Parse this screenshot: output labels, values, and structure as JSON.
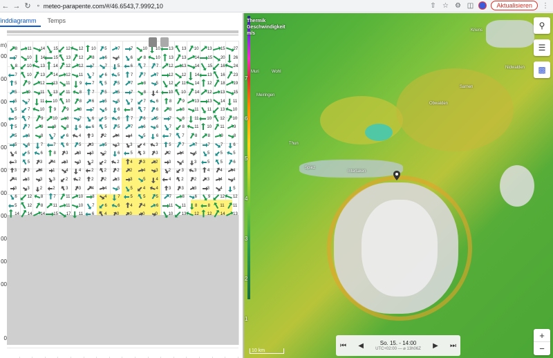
{
  "browser": {
    "url": "meteo-parapente.com/#/46.6543,7.9992,10",
    "update_label": "Aktualisieren"
  },
  "tabs": [
    {
      "label": "Winddiagramm"
    },
    {
      "label": "Temps"
    }
  ],
  "altitudes": [
    "m)",
    "00",
    "00",
    "00",
    "00",
    "00",
    "00",
    "00",
    "00",
    "00",
    "00",
    "00",
    "0"
  ],
  "hours": [
    "6h",
    "7h",
    "8h",
    "9h",
    "10h",
    "11h",
    "12h",
    "13h",
    "14h",
    "15h",
    "16h",
    "17h",
    "18h",
    "19h",
    "20h",
    "21h",
    "22h",
    "23h"
  ],
  "row_values": [
    [
      "8",
      "11",
      "14",
      "15",
      "12",
      "12",
      "10",
      "5",
      "7",
      "7",
      "10",
      "10",
      "13",
      "13",
      "10",
      "13",
      "15",
      "27"
    ],
    [
      "7",
      "10",
      "14",
      "15",
      "13",
      "12",
      "8",
      "6",
      "4",
      "6",
      "8",
      "10",
      "13",
      "13",
      "14",
      "15",
      "20",
      "26"
    ],
    [
      "8",
      "10",
      "13",
      "14",
      "12",
      "12",
      "7",
      "7",
      "5",
      "6",
      "7",
      "7",
      "12",
      "13",
      "14",
      "15",
      "16",
      "24"
    ],
    [
      "7",
      "10",
      "13",
      "14",
      "12",
      "11",
      "7",
      "6",
      "5",
      "7",
      "7",
      "7",
      "12",
      "12",
      "14",
      "13",
      "16",
      "23"
    ],
    [
      "5",
      "9",
      "12",
      "13",
      "11",
      "9",
      "7",
      "5",
      "5",
      "7",
      "8",
      "5",
      "12",
      "11",
      "14",
      "12",
      "18",
      "19"
    ],
    [
      "5",
      "9",
      "11",
      "13",
      "11",
      "8",
      "7",
      "5",
      "5",
      "7",
      "8",
      "4",
      "10",
      "10",
      "14",
      "12",
      "13",
      "15"
    ],
    [
      "5",
      "7",
      "11",
      "10",
      "10",
      "8",
      "6",
      "5",
      "5",
      "7",
      "7",
      "6",
      "8",
      "9",
      "13",
      "13",
      "14",
      "11"
    ],
    [
      "5",
      "7",
      "10",
      "9",
      "9",
      "8",
      "7",
      "6",
      "6",
      "8",
      "7",
      "6",
      "8",
      "8",
      "11",
      "11",
      "13",
      "10"
    ],
    [
      "5",
      "7",
      "9",
      "10",
      "8",
      "7",
      "6",
      "5",
      "6",
      "7",
      "6",
      "5",
      "7",
      "8",
      "11",
      "10",
      "12",
      "10"
    ],
    [
      "5",
      "7",
      "9",
      "9",
      "8",
      "6",
      "6",
      "5",
      "5",
      "7",
      "6",
      "6",
      "7",
      "8",
      "11",
      "10",
      "11",
      "9"
    ],
    [
      "5",
      "6",
      "8",
      "7",
      "6",
      "4",
      "3",
      "2",
      "4",
      "4",
      "5",
      "6",
      "7",
      "7",
      "8",
      "8",
      "9",
      "8"
    ],
    [
      "5",
      "6",
      "7",
      "7",
      "6",
      "5",
      "3",
      "5",
      "3",
      "3",
      "4",
      "3",
      "5",
      "7",
      "7",
      "7",
      "7",
      "6"
    ],
    [
      "4",
      "5",
      "6",
      "8",
      "3",
      "3",
      "3",
      "2",
      "6",
      "5",
      "3",
      "3",
      "2",
      "4",
      "4",
      "5",
      "5",
      "5"
    ],
    [
      "3",
      "5",
      "3",
      "4",
      "3",
      "3",
      "2",
      "2",
      "2",
      "4",
      "3",
      "2",
      "3",
      "4",
      "3",
      "5",
      "5",
      "6"
    ],
    [
      "3",
      "3",
      "4",
      "1",
      "4",
      "4",
      "2",
      "2",
      "2",
      "2",
      "4",
      "3",
      "2",
      "3",
      "3",
      "4",
      "4",
      "4"
    ],
    [
      "4",
      "3",
      "3",
      "3",
      "2",
      "2",
      "2",
      "2",
      "3",
      "3",
      "5",
      "4",
      "4",
      "2",
      "2",
      "3",
      "4",
      "4"
    ],
    [
      "3",
      "3",
      "2",
      "2",
      "3",
      "3",
      "4",
      "4",
      "5",
      "5",
      "4",
      "4",
      "3",
      "3",
      "3",
      "3",
      "4",
      "5"
    ],
    [
      "6",
      "12",
      "8",
      "7",
      "11",
      "10",
      "8",
      "4",
      "7",
      "5",
      "5",
      "5",
      "7",
      "8",
      "6",
      "9",
      "12",
      "12"
    ],
    [
      "5",
      "12",
      "8",
      "11",
      "11",
      "10",
      "7",
      "6",
      "6",
      "4",
      "4",
      "6",
      "11",
      "11",
      "8",
      "8",
      "11",
      "11"
    ],
    [
      "14",
      "14",
      "14",
      "15",
      "17",
      "11",
      "6",
      "4",
      "0",
      "0",
      "0",
      "0",
      "10",
      "13",
      "12",
      "12",
      "14",
      "13"
    ]
  ],
  "map": {
    "legend_title": "Thermik",
    "legend_sub": "Geschwindigkeit",
    "legend_unit": "m/s",
    "scale_numbers": [
      "7",
      "6",
      "5",
      "4",
      "3",
      "2",
      "1"
    ],
    "time_main": "So. 15. - 14:00",
    "time_sub": "UTC+02:00 — ⌀ 13h06Z",
    "km_label": "10 km",
    "places": [
      "Muri",
      "Wohl",
      "Meiringen",
      "Thun",
      "Spiez",
      "Interlaken",
      "Obwalden",
      "Nidwalden",
      "Kriens",
      "Sarnen"
    ]
  }
}
